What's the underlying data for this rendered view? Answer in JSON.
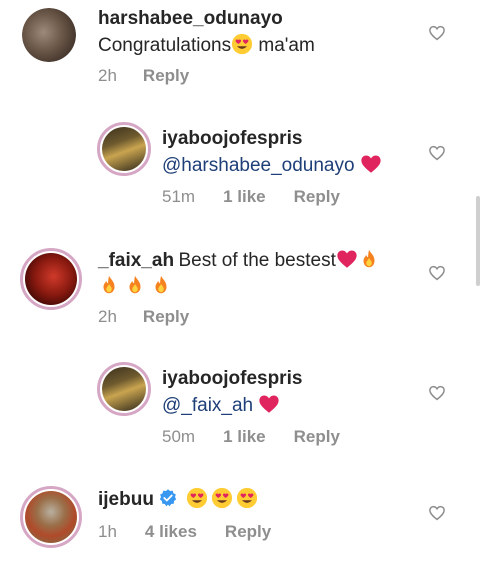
{
  "comments": [
    {
      "username": "harshabee_odunayo",
      "text": "Congratulations",
      "text_suffix": " ma'am",
      "time": "2h",
      "likes": "",
      "reply": "Reply"
    },
    {
      "username": "iyaboojofespris",
      "mention": "@harshabee_odunayo",
      "time": "51m",
      "likes": "1 like",
      "reply": "Reply"
    },
    {
      "username": "_faix_ah",
      "text": "Best of the bestest",
      "time": "2h",
      "likes": "",
      "reply": "Reply"
    },
    {
      "username": "iyaboojofespris",
      "mention": "@_faix_ah",
      "time": "50m",
      "likes": "1 like",
      "reply": "Reply"
    },
    {
      "username": "ijebuu",
      "time": "1h",
      "likes": "4 likes",
      "reply": "Reply"
    }
  ],
  "icons": {
    "like": "heart-outline-icon",
    "verified": "verified-badge-icon",
    "heart_eyes": "heart-eyes-emoji",
    "red_heart": "red-heart-emoji",
    "fire": "fire-emoji"
  },
  "colors": {
    "mention": "#1e3f78",
    "meta": "#8e8e8e",
    "verified": "#3897f0",
    "heart": "#e0245e"
  }
}
